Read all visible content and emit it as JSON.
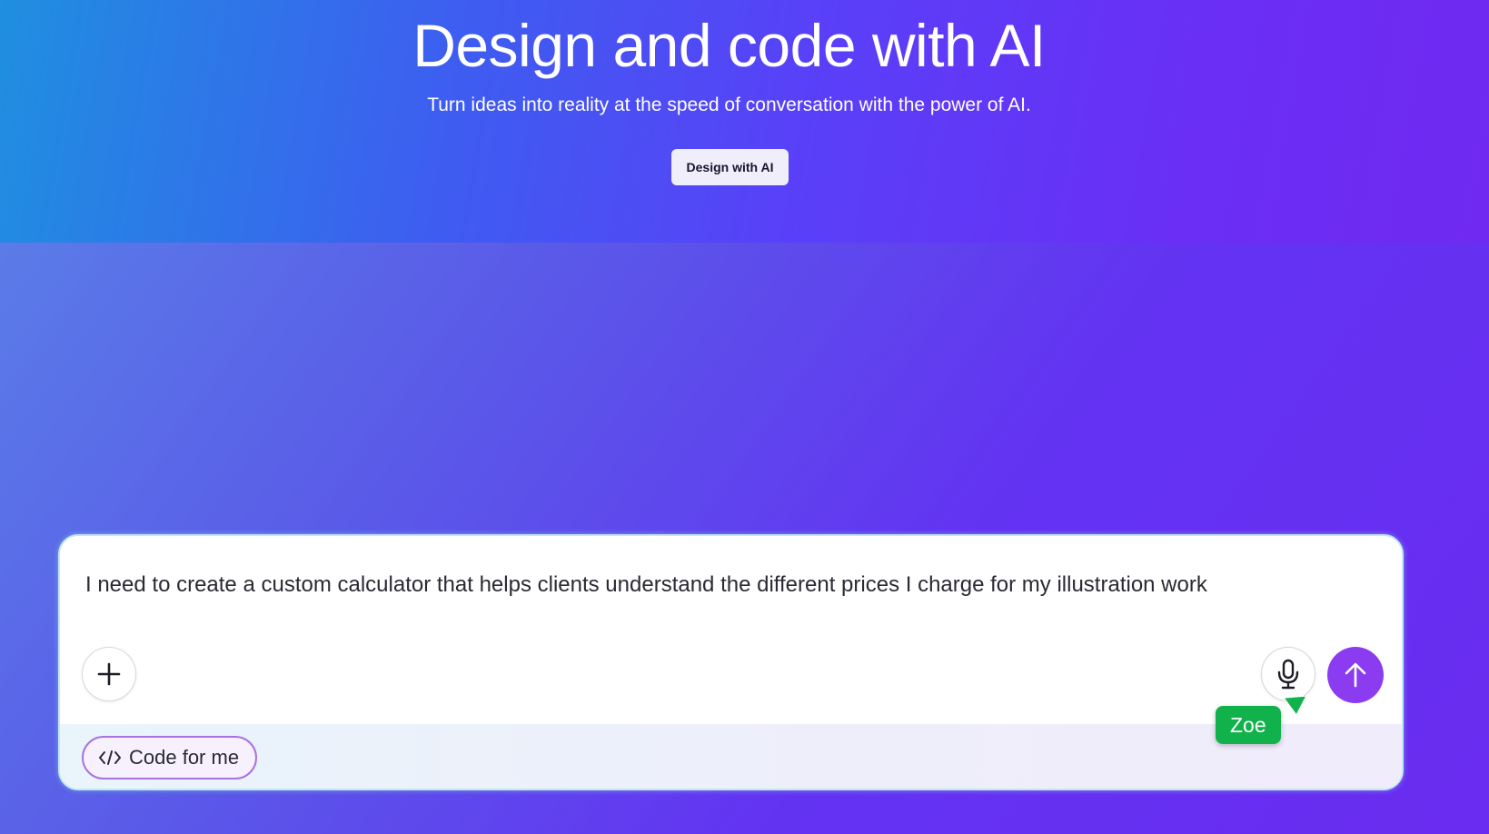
{
  "hero": {
    "title": "Design and code with AI",
    "subtitle": "Turn ideas into reality at the speed of conversation with the power of AI.",
    "cta_label": "Design with AI"
  },
  "composer": {
    "prompt_text": "I need to create a custom calculator that helps clients understand the different prices I charge for my illustration work",
    "add_icon": "plus-icon",
    "mic_icon": "microphone-icon",
    "send_icon": "arrow-up-icon",
    "mode_chip": {
      "icon": "code-icon",
      "label": "Code for me"
    }
  },
  "cursor": {
    "name": "Zoe",
    "color": "#11b24b"
  },
  "colors": {
    "accent": "#8b3cf0",
    "chip_border": "#a972e0"
  }
}
